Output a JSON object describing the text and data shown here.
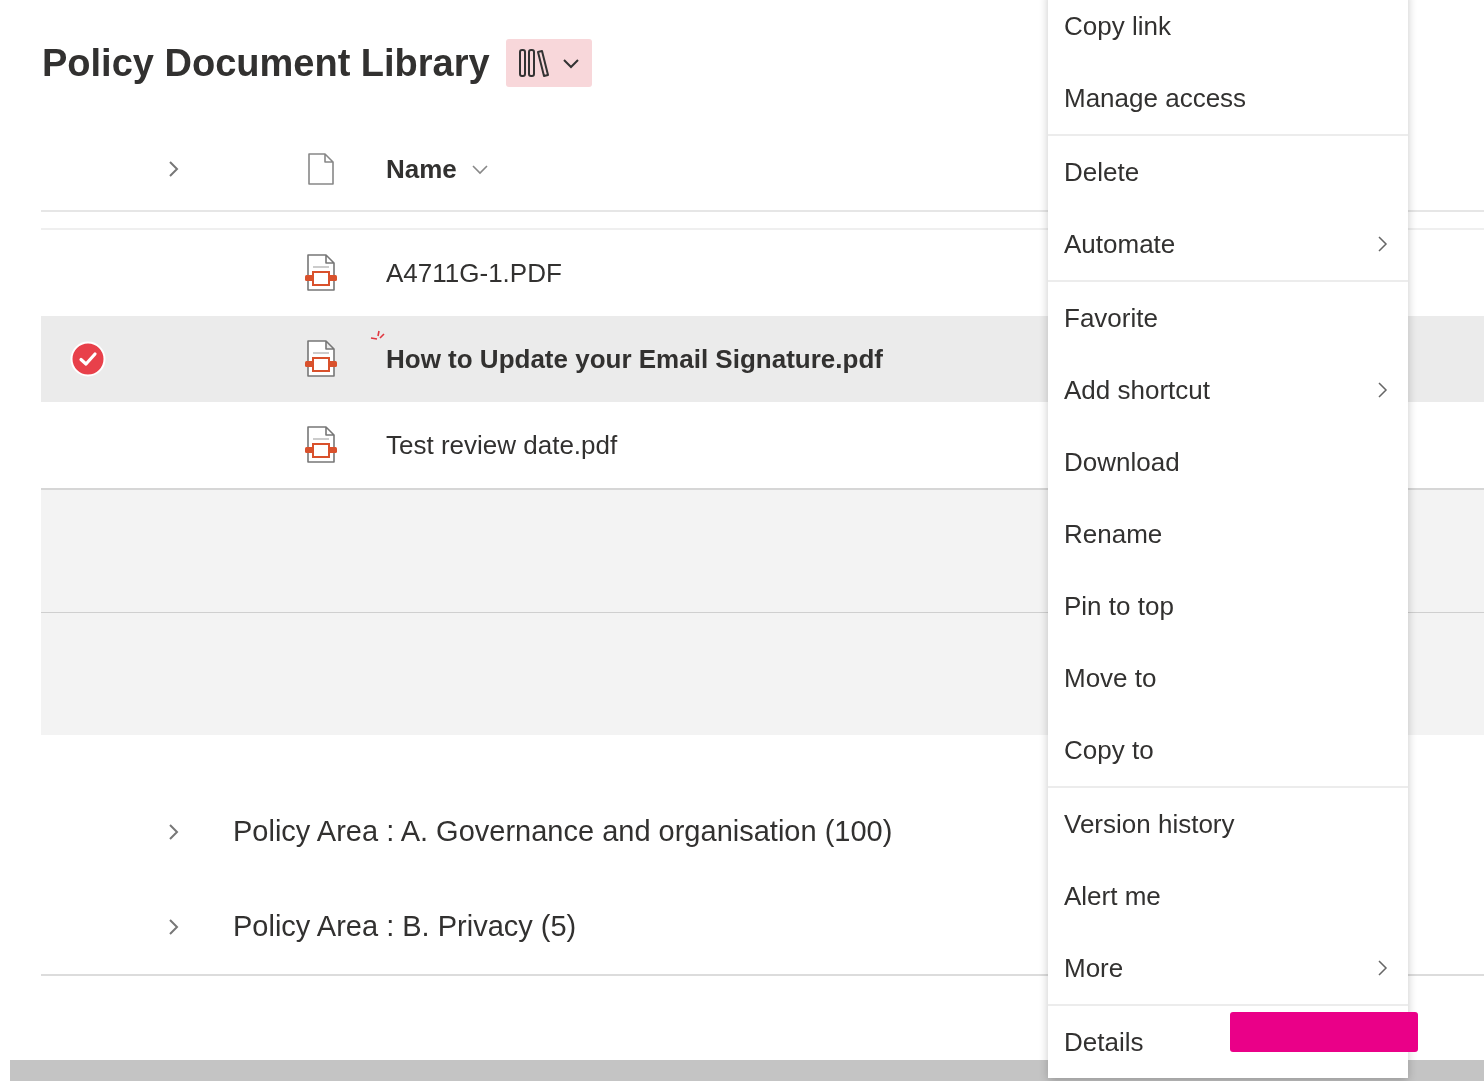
{
  "title": "Policy Document Library",
  "header": {
    "name_label": "Name"
  },
  "rows": [
    {
      "name": "A4711G-1.PDF",
      "selected": false,
      "new": false
    },
    {
      "name": "How to Update your Email Signature.pdf",
      "selected": true,
      "new": true
    },
    {
      "name": "Test review date.pdf",
      "selected": false,
      "new": false
    }
  ],
  "groups": [
    {
      "label": "Policy Area : A. Governance and organisation (100)",
      "expanded": false
    },
    {
      "label": "Policy Area : B. Privacy (5)",
      "expanded": false
    }
  ],
  "context_menu": {
    "sections": [
      [
        {
          "label": "Copy link",
          "submenu": false
        },
        {
          "label": "Manage access",
          "submenu": false
        }
      ],
      [
        {
          "label": "Delete",
          "submenu": false
        },
        {
          "label": "Automate",
          "submenu": true
        }
      ],
      [
        {
          "label": "Favorite",
          "submenu": false
        },
        {
          "label": "Add shortcut",
          "submenu": true
        },
        {
          "label": "Download",
          "submenu": false
        },
        {
          "label": "Rename",
          "submenu": false
        },
        {
          "label": "Pin to top",
          "submenu": false
        },
        {
          "label": "Move to",
          "submenu": false
        },
        {
          "label": "Copy to",
          "submenu": false
        }
      ],
      [
        {
          "label": "Version history",
          "submenu": false
        },
        {
          "label": "Alert me",
          "submenu": false
        },
        {
          "label": "More",
          "submenu": true
        }
      ],
      [
        {
          "label": "Details"
        }
      ]
    ]
  }
}
